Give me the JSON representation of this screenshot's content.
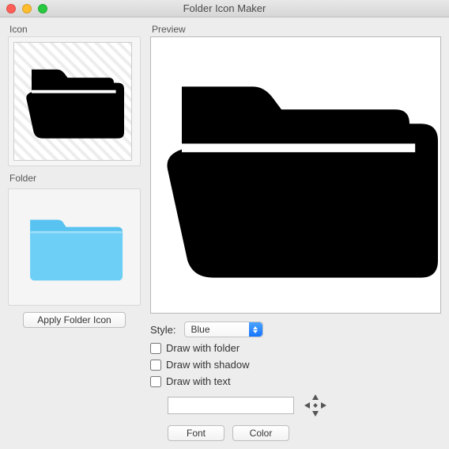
{
  "window": {
    "title": "Folder Icon Maker"
  },
  "left": {
    "icon_label": "Icon",
    "folder_label": "Folder",
    "apply_button": "Apply Folder Icon"
  },
  "right": {
    "preview_label": "Preview"
  },
  "controls": {
    "style_label": "Style:",
    "style_value": "Blue",
    "draw_with_folder": "Draw with folder",
    "draw_with_shadow": "Draw with shadow",
    "draw_with_text": "Draw with text",
    "text_value": "",
    "font_button": "Font",
    "color_button": "Color"
  },
  "colors": {
    "folder_blue": "#6ecff6",
    "folder_blue_tab": "#58c3f0"
  }
}
